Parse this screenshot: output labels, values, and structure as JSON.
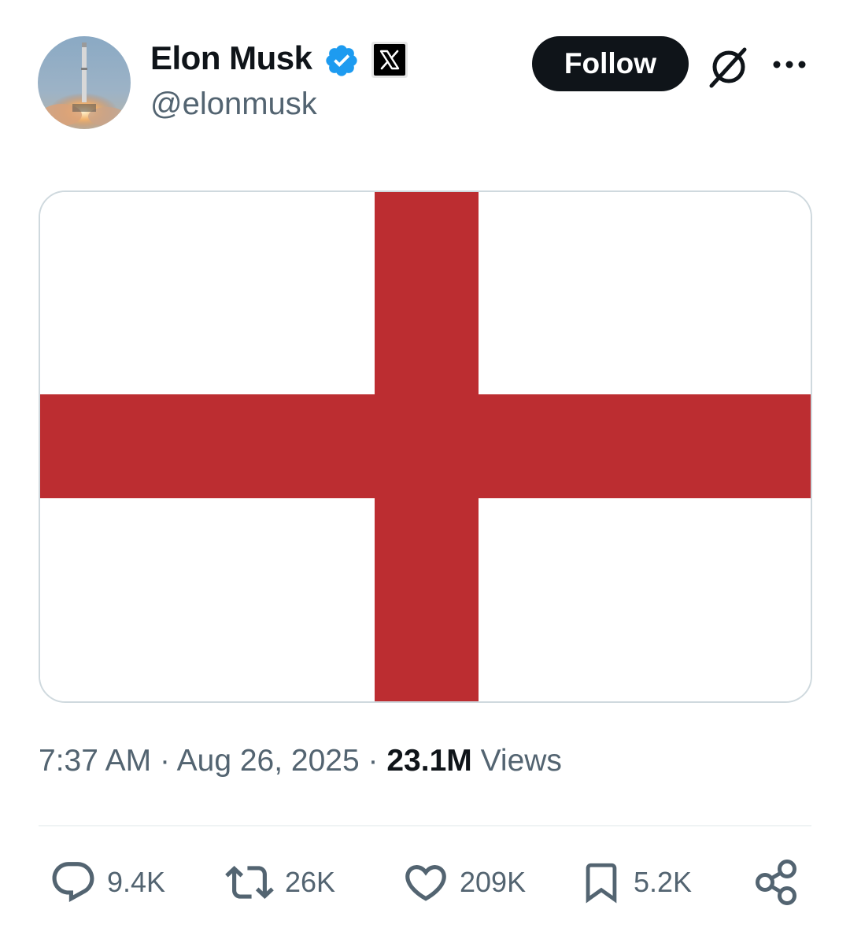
{
  "tweet": {
    "author": {
      "display_name": "Elon Musk",
      "handle": "@elonmusk",
      "verified": true,
      "affiliation_badge": "x-logo-icon",
      "avatar_icon": "rocket-launch-avatar"
    },
    "follow_label": "Follow",
    "menu_icons": [
      "grok-icon",
      "more-icon"
    ],
    "media": {
      "type": "image",
      "description_icon": "england-flag-image",
      "colors": {
        "background": "#ffffff",
        "cross": "#bc2d31"
      }
    },
    "meta": {
      "time": "7:37 AM",
      "separator": "·",
      "date": "Aug 26, 2025",
      "views_count": "23.1M",
      "views_label": "Views"
    },
    "actions": {
      "replies": "9.4K",
      "reposts": "26K",
      "likes": "209K",
      "bookmarks": "5.2K"
    }
  },
  "colors": {
    "text_primary": "#0f1419",
    "text_secondary": "#536471",
    "verified_blue": "#1d9bf0",
    "border": "#cfd9de",
    "divider": "#eff3f4"
  }
}
